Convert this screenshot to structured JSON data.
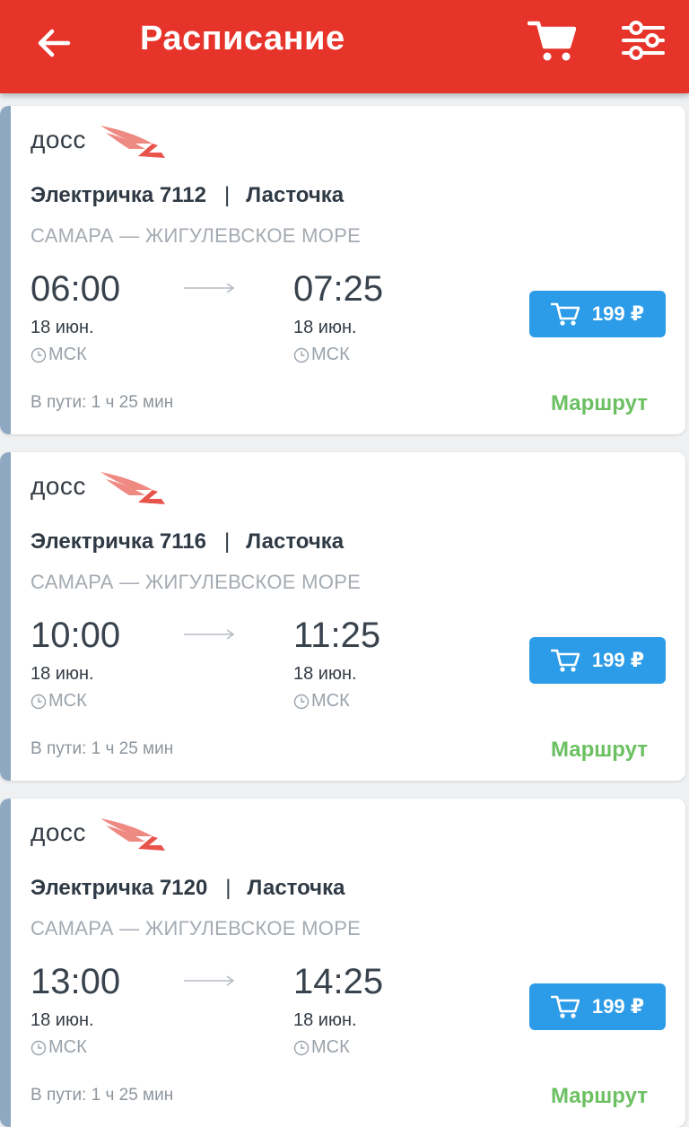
{
  "header": {
    "title": "Расписание",
    "back_icon": "arrow-left-icon",
    "cart_icon": "cart-icon",
    "filter_icon": "sliders-icon"
  },
  "colors": {
    "header": "#e7342b",
    "buy_button": "#2d9ce8",
    "route_link": "#6cc062",
    "accent": "#8fa8c2"
  },
  "trains": [
    {
      "carrier": "досс",
      "train_name": "Электричка 7112",
      "separator": "|",
      "train_type": "Ласточка",
      "route": "САМАРА — ЖИГУЛЕВСКОЕ МОРЕ",
      "departure_time": "06:00",
      "arrival_time": "07:25",
      "departure_date": "18 июн.",
      "arrival_date": "18 июн.",
      "departure_tz": "МСК",
      "arrival_tz": "МСК",
      "price": "199 ₽",
      "duration": "В пути: 1 ч 25 мин",
      "route_link": "Маршрут"
    },
    {
      "carrier": "досс",
      "train_name": "Электричка 7116",
      "separator": "|",
      "train_type": "Ласточка",
      "route": "САМАРА — ЖИГУЛЕВСКОЕ МОРЕ",
      "departure_time": "10:00",
      "arrival_time": "11:25",
      "departure_date": "18 июн.",
      "arrival_date": "18 июн.",
      "departure_tz": "МСК",
      "arrival_tz": "МСК",
      "price": "199 ₽",
      "duration": "В пути: 1 ч 25 мин",
      "route_link": "Маршрут"
    },
    {
      "carrier": "досс",
      "train_name": "Электричка 7120",
      "separator": "|",
      "train_type": "Ласточка",
      "route": "САМАРА — ЖИГУЛЕВСКОЕ МОРЕ",
      "departure_time": "13:00",
      "arrival_time": "14:25",
      "departure_date": "18 июн.",
      "arrival_date": "18 июн.",
      "departure_tz": "МСК",
      "arrival_tz": "МСК",
      "price": "199 ₽",
      "duration": "В пути: 1 ч 25 мин",
      "route_link": "Маршрут"
    }
  ]
}
